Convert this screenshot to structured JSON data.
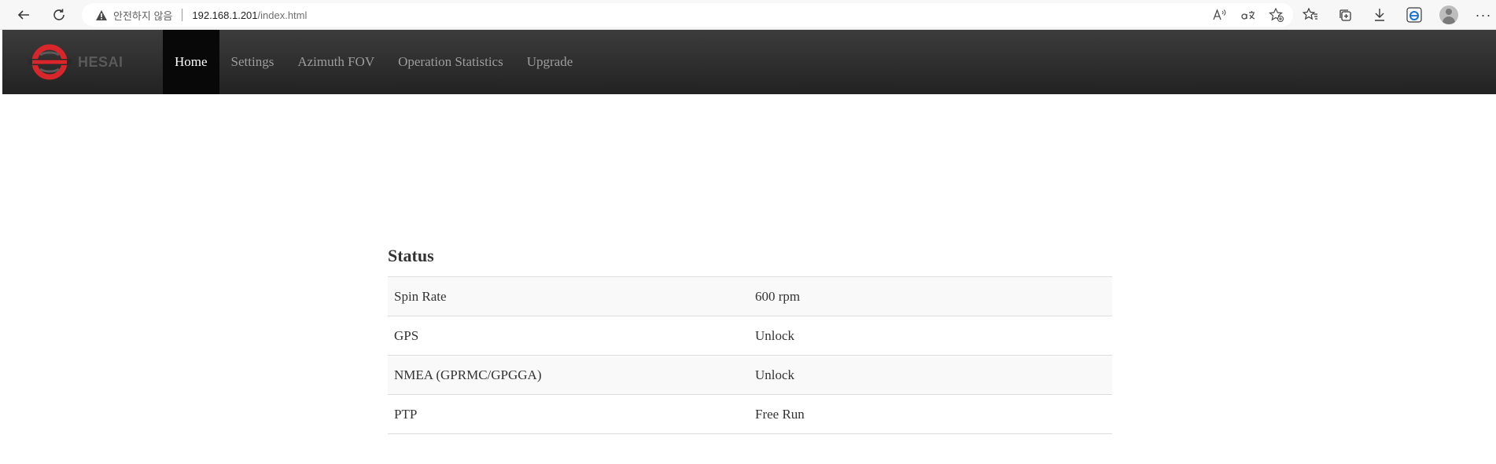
{
  "browser": {
    "security_text": "안전하지 않음",
    "url_host": "192.168.1.201",
    "url_path": "/index.html"
  },
  "nav": {
    "brand": "HESAI",
    "items": [
      {
        "label": "Home",
        "active": true
      },
      {
        "label": "Settings",
        "active": false
      },
      {
        "label": "Azimuth FOV",
        "active": false
      },
      {
        "label": "Operation Statistics",
        "active": false
      },
      {
        "label": "Upgrade",
        "active": false
      }
    ]
  },
  "status": {
    "title": "Status",
    "rows": [
      {
        "label": "Spin Rate",
        "value": "600 rpm"
      },
      {
        "label": "GPS",
        "value": "Unlock"
      },
      {
        "label": "NMEA (GPRMC/GPGGA)",
        "value": "Unlock"
      },
      {
        "label": "PTP",
        "value": "Free Run"
      }
    ]
  },
  "colors": {
    "navbar": "#222222",
    "active_nav": "#080808",
    "logo_red": "#d9262b"
  }
}
